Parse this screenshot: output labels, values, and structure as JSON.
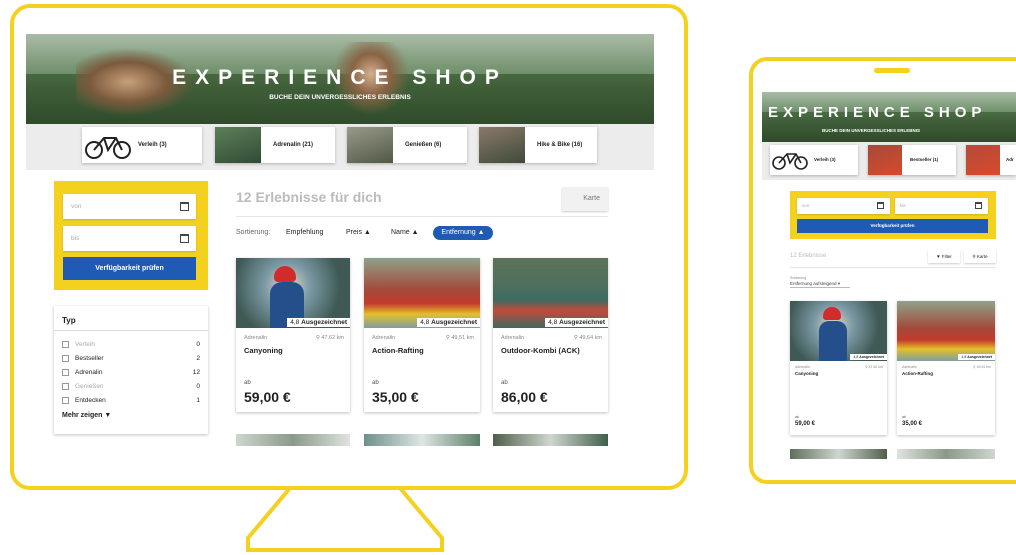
{
  "desktop": {
    "hero": {
      "title": "EXPERIENCE SHOP",
      "subtitle": "BUCHE DEIN UNVERGESSLICHES ERLEBNIS"
    },
    "categories": [
      {
        "label": "Verleih (3)"
      },
      {
        "label": "Adrenalin (21)"
      },
      {
        "label": "Genießen (6)"
      },
      {
        "label": "Hike & Bike (16)"
      }
    ],
    "date_from_placeholder": "von",
    "date_to_placeholder": "bis",
    "check_button": "Verfügbarkeit prüfen",
    "results_title": "12 Erlebnisse für dich",
    "map_button": "Karte",
    "sort": {
      "label": "Sortierung:",
      "options": [
        "Empfehlung",
        "Preis",
        "Name",
        "Entfernung"
      ],
      "active": "Entfernung"
    },
    "filter": {
      "title": "Typ",
      "items": [
        {
          "label": "Verleih",
          "count": "0"
        },
        {
          "label": "Bestseller",
          "count": "2"
        },
        {
          "label": "Adrenalin",
          "count": "12"
        },
        {
          "label": "Genießen",
          "count": "0"
        },
        {
          "label": "Entdecken",
          "count": "1"
        }
      ],
      "more": "Mehr zeigen"
    },
    "cards": [
      {
        "rating": "4,8",
        "rating_label": "Ausgezeichnet",
        "category": "Adrenalin",
        "distance": "47,62 km",
        "title": "Canyoning",
        "price_prefix": "ab",
        "price": "59,00 €"
      },
      {
        "rating": "4,8",
        "rating_label": "Ausgezeichnet",
        "category": "Adrenalin",
        "distance": "49,51 km",
        "title": "Action-Rafting",
        "price_prefix": "ab",
        "price": "35,00 €"
      },
      {
        "rating": "4,8",
        "rating_label": "Ausgezeichnet",
        "category": "Adrenalin",
        "distance": "49,64 km",
        "title": "Outdoor-Kombi (ACK)",
        "price_prefix": "ab",
        "price": "86,00 €"
      }
    ]
  },
  "tablet": {
    "hero": {
      "title": "EXPERIENCE SHOP",
      "subtitle": "BUCHE DEIN UNVERGESSLICHES ERLEBNIS"
    },
    "categories": [
      {
        "label": "Verleih (3)"
      },
      {
        "label": "Bestseller (1)"
      },
      {
        "label": "Adr"
      }
    ],
    "date_from_placeholder": "von",
    "date_to_placeholder": "bis",
    "check_button": "Verfügbarkeit prüfen",
    "results_title": "12 Erlebnisse",
    "filter_button": "Filter",
    "map_button": "Karte",
    "sort_label": "Sortierung",
    "sort_value": "Entfernung aufsteigend",
    "cards": [
      {
        "rating": "4,8",
        "rating_label": "Ausgezeichnet",
        "category": "Adrenalin",
        "distance": "47,62 km",
        "title": "Canyoning",
        "price_prefix": "ab",
        "price": "59,00 €"
      },
      {
        "rating": "4,8",
        "rating_label": "Ausgezeichnet",
        "category": "Adrenalin",
        "distance": "49,51 km",
        "title": "Action-Rafting",
        "price_prefix": "ab",
        "price": "35,00 €"
      }
    ]
  },
  "colors": {
    "frame": "#f5d11f",
    "primary": "#1f5bb5"
  }
}
